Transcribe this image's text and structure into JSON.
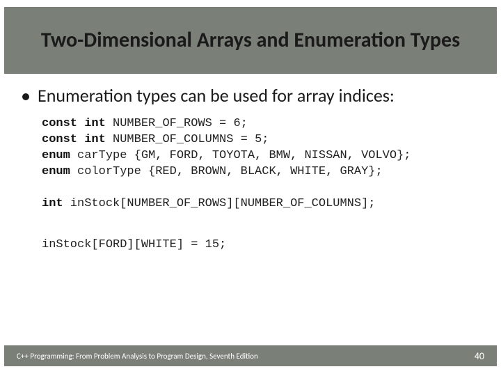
{
  "header": {
    "title": "Two-Dimensional Arrays and Enumeration Types"
  },
  "body": {
    "bullet1": "Enumeration types can be used for array indices:"
  },
  "code": {
    "kw_const_int_1": "const int",
    "line1_rest": " NUMBER_OF_ROWS = 6;",
    "kw_const_int_2": "const int",
    "line2_rest": " NUMBER_OF_COLUMNS = 5;",
    "kw_enum_1": "enum",
    "line3_rest": " carType {GM, FORD, TOYOTA, BMW, NISSAN, VOLVO};",
    "kw_enum_2": "enum",
    "line4_rest": " colorType {RED, BROWN, BLACK, WHITE, GRAY};",
    "kw_int": "int",
    "line5_rest": " inStock[NUMBER_OF_ROWS][NUMBER_OF_COLUMNS];",
    "stmt": "inStock[FORD][WHITE] = 15;"
  },
  "footer": {
    "text": "C++ Programming: From Problem Analysis to Program Design, Seventh Edition",
    "page": "40"
  }
}
